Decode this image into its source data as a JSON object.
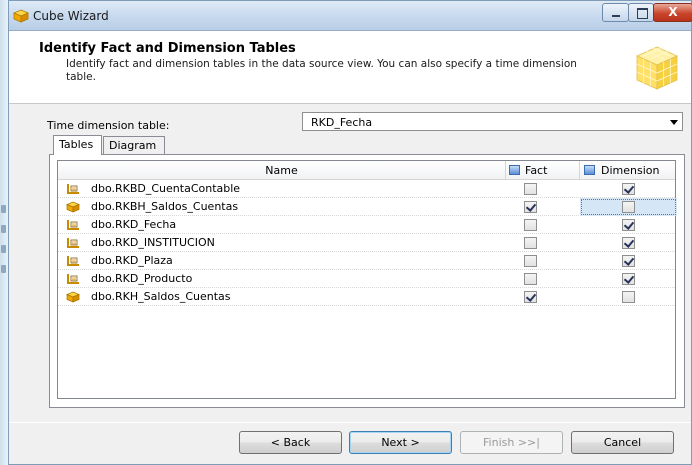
{
  "window": {
    "title": "Cube Wizard",
    "minimize_icon": "minimize-icon",
    "maximize_icon": "maximize-icon",
    "close_icon": "close-icon",
    "close_glyph": "X"
  },
  "header": {
    "title": "Identify Fact and Dimension Tables",
    "description": "Identify fact and dimension tables in the data source view. You can also specify a time dimension table."
  },
  "time_dimension": {
    "label": "Time dimension table:",
    "value": "RKD_Fecha"
  },
  "tabs": [
    {
      "label": "Tables",
      "active": true
    },
    {
      "label": "Diagram",
      "active": false
    }
  ],
  "grid": {
    "columns": {
      "name": "Name",
      "fact": "Fact",
      "dimension": "Dimension"
    },
    "rows": [
      {
        "name": "dbo.RKBD_CuentaContable",
        "icon": "dimension-table-icon",
        "fact": false,
        "dimension": true,
        "selected": false
      },
      {
        "name": "dbo.RKBH_Saldos_Cuentas",
        "icon": "fact-table-icon",
        "fact": true,
        "dimension": false,
        "selected": true
      },
      {
        "name": "dbo.RKD_Fecha",
        "icon": "dimension-table-icon",
        "fact": false,
        "dimension": true,
        "selected": false
      },
      {
        "name": "dbo.RKD_INSTITUCION",
        "icon": "dimension-table-icon",
        "fact": false,
        "dimension": true,
        "selected": false
      },
      {
        "name": "dbo.RKD_Plaza",
        "icon": "dimension-table-icon",
        "fact": false,
        "dimension": true,
        "selected": false
      },
      {
        "name": "dbo.RKD_Producto",
        "icon": "dimension-table-icon",
        "fact": false,
        "dimension": true,
        "selected": false
      },
      {
        "name": "dbo.RKH_Saldos_Cuentas",
        "icon": "fact-table-icon",
        "fact": true,
        "dimension": false,
        "selected": false
      }
    ]
  },
  "buttons": {
    "back": "< Back",
    "next": "Next >",
    "finish": "Finish >>|",
    "cancel": "Cancel"
  },
  "colors": {
    "fact_icon": "#f0b400",
    "dimension_icon": "#e0a000",
    "selection": "#d5e6f7"
  }
}
